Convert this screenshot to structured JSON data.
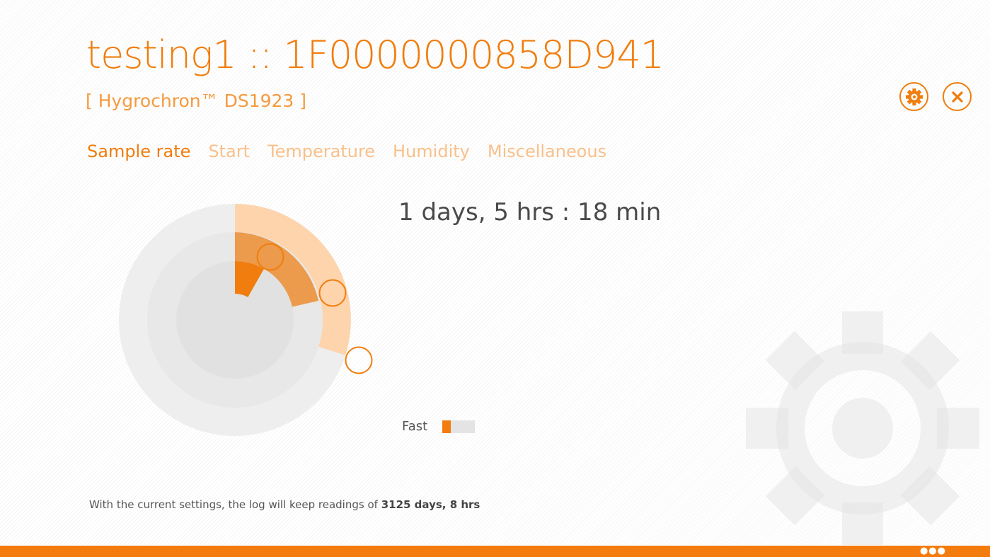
{
  "header": {
    "title": "testing1 :: 1F0000000858D941",
    "subtitle": "[ Hygrochron™ DS1923 ]"
  },
  "tabs": [
    {
      "label": "Sample rate",
      "active": true
    },
    {
      "label": "Start",
      "active": false
    },
    {
      "label": "Temperature",
      "active": false
    },
    {
      "label": "Humidity",
      "active": false
    },
    {
      "label": "Miscellaneous",
      "active": false
    }
  ],
  "toolbar": {
    "settings_icon": "gear-icon",
    "close_icon": "close-icon"
  },
  "sample_rate": {
    "duration_text": "1 days, 5 hrs : 18 min",
    "speed_label": "Fast",
    "speed_level": 0.25
  },
  "footer": {
    "prefix": "With the current settings, the log will keep readings of",
    "value": "3125 days, 8 hrs"
  },
  "colors": {
    "accent": "#f07d0d",
    "accent_light": "#f9c08a"
  }
}
